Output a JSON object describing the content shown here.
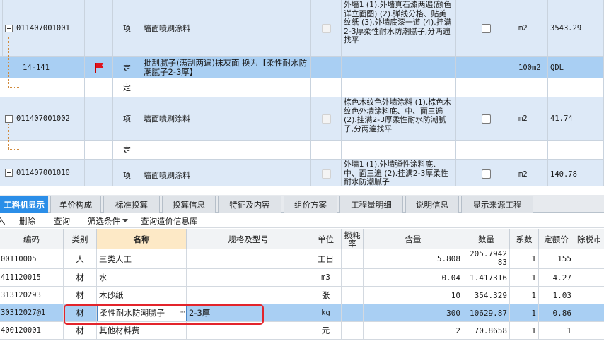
{
  "upper_rows": [
    {
      "kind": "item",
      "code": "011407001001",
      "type": "项",
      "name": "墙面喷刷涂料",
      "feature": "外墙1 (1).外墙真石漆两遍(颜色详立面图) (2).弹线分格、贴美纹纸 (3).外墙底漆一道 (4).挂满2-3厚柔性耐水防潮腻子,分两遍找平",
      "unit": "m2",
      "qty": "3543.29"
    },
    {
      "kind": "sub-selected",
      "code": "14-141",
      "type": "定",
      "name": "批刮腻子(满刮两遍)抹灰面  换为【柔性耐水防潮腻子2-3厚】",
      "feature": "",
      "unit": "100m2",
      "qty": "QDL",
      "flag": true
    },
    {
      "kind": "sub",
      "code": "",
      "type": "定",
      "name": "",
      "feature": "",
      "unit": "",
      "qty": ""
    },
    {
      "kind": "item",
      "code": "011407001002",
      "type": "项",
      "name": "墙面喷刷涂料",
      "feature": "棕色木纹色外墙涂料 (1).棕色木纹色外墙涂料底、中、面三遍 (2).挂满2-3厚柔性耐水防潮腻子,分两遍找平",
      "unit": "m2",
      "qty": "41.74"
    },
    {
      "kind": "sub",
      "code": "",
      "type": "定",
      "name": "",
      "feature": "",
      "unit": "",
      "qty": ""
    },
    {
      "kind": "item",
      "code": "011407001010",
      "type": "项",
      "name": "墙面喷刷涂料",
      "feature": "外墙1 (1).外墙弹性涂料底、中、面三遍 (2).挂满2-3厚柔性耐水防潮腻子",
      "unit": "m2",
      "qty": "140.78"
    }
  ],
  "tabs": [
    {
      "label": "工料机显示",
      "active": true
    },
    {
      "label": "单价构成",
      "active": false
    },
    {
      "label": "标准换算",
      "active": false
    },
    {
      "label": "换算信息",
      "active": false
    },
    {
      "label": "特征及内容",
      "active": false
    },
    {
      "label": "组价方案",
      "active": false
    },
    {
      "label": "工程量明细",
      "active": false
    },
    {
      "label": "说明信息",
      "active": false
    },
    {
      "label": "显示来源工程",
      "active": false
    }
  ],
  "toolbar": {
    "insert": "入",
    "delete": "删除",
    "query": "查询",
    "filter": "筛选条件",
    "query_price_db": "查询造价信息库"
  },
  "lower_headers": {
    "code": "编码",
    "category": "类别",
    "name": "名称",
    "spec": "规格及型号",
    "unit": "单位",
    "loss_rate_1": "损耗",
    "loss_rate_2": "率",
    "content": "含量",
    "quantity": "数量",
    "coef": "系数",
    "quota_price": "定额价",
    "tax_excl": "除税市"
  },
  "lower_rows": [
    {
      "code": "00110005",
      "category": "人",
      "name": "三类人工",
      "spec": "",
      "unit": "工日",
      "content": "5.808",
      "quantity": "205.794283",
      "coef": "1",
      "price": "155",
      "selected": false
    },
    {
      "code": "411120015",
      "category": "材",
      "name": "水",
      "spec": "",
      "unit": "m3",
      "content": "0.04",
      "quantity": "1.417316",
      "coef": "1",
      "price": "4.27",
      "selected": false
    },
    {
      "code": "313120293",
      "category": "材",
      "name": "木砂纸",
      "spec": "",
      "unit": "张",
      "content": "10",
      "quantity": "354.329",
      "coef": "1",
      "price": "1.03",
      "selected": false
    },
    {
      "code": "30312027@1",
      "category": "材",
      "name": "柔性耐水防潮腻子",
      "spec": "2-3厚",
      "unit": "kg",
      "content": "300",
      "quantity": "10629.87",
      "coef": "1",
      "price": "0.86",
      "selected": true
    },
    {
      "code": "400120001",
      "category": "材",
      "name": "其他材料费",
      "spec": "",
      "unit": "元",
      "content": "2",
      "quantity": "70.8658",
      "coef": "1",
      "price": "1",
      "selected": false
    }
  ],
  "lower_ellipsis": "···"
}
